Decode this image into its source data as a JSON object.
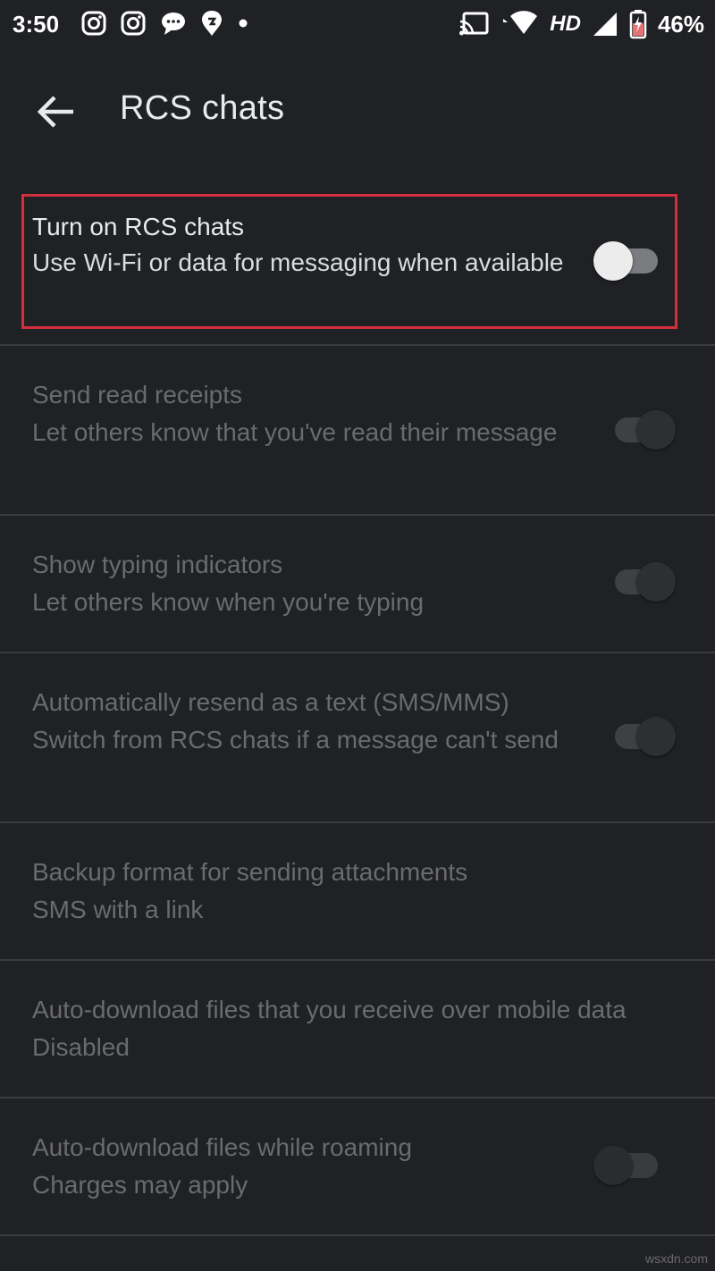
{
  "status_bar": {
    "time": "3:50",
    "left_icons": [
      "instagram-icon",
      "instagram-icon",
      "chat-bubble-icon",
      "swiggy-icon",
      "notification-dot-icon"
    ],
    "hd_label": "HD",
    "battery_percent": "46%",
    "right_icons": [
      "cast-icon",
      "wifi-icon",
      "signal-icon",
      "battery-icon"
    ]
  },
  "app_bar": {
    "title": "RCS chats",
    "back_icon": "arrow-back-icon"
  },
  "settings": [
    {
      "title": "Turn on RCS chats",
      "subtitle": "Use Wi-Fi or data for messaging when available",
      "switch": "off",
      "enabled": true
    },
    {
      "title": "Send read receipts",
      "subtitle": "Let others know that you've read their message",
      "switch": "on",
      "enabled": false
    },
    {
      "title": "Show typing indicators",
      "subtitle": "Let others know when you're typing",
      "switch": "on",
      "enabled": false
    },
    {
      "title": "Automatically resend as a text (SMS/MMS)",
      "subtitle": "Switch from RCS chats if a message can't send",
      "switch": "on",
      "enabled": false
    },
    {
      "title": "Backup format for sending attachments",
      "subtitle": "SMS with a link",
      "enabled": false
    },
    {
      "title": "Auto-download files that you receive over mobile data",
      "subtitle": "Disabled",
      "enabled": false
    },
    {
      "title": "Auto-download files while roaming",
      "subtitle": "Charges may apply",
      "switch": "off",
      "enabled": false
    }
  ],
  "watermark": "wsxdn.com",
  "colors": {
    "background": "#202124",
    "highlight_border": "#d32f3d",
    "text_enabled": "#e8eaed",
    "text_disabled": "#6a6b6e"
  }
}
